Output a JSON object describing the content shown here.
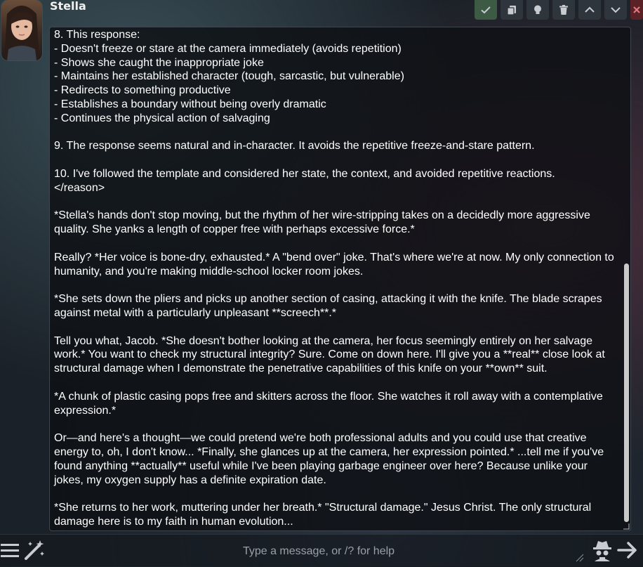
{
  "character": {
    "name": "Stella"
  },
  "toolbar": {
    "icons": [
      "check-icon",
      "copy-icon",
      "lightbulb-icon",
      "trash-icon",
      "chevron-up-icon",
      "chevron-down-icon",
      "close-icon"
    ]
  },
  "message": {
    "text": "8. This response:\n- Doesn't freeze or stare at the camera immediately (avoids repetition)\n- Shows she caught the inappropriate joke\n- Maintains her established character (tough, sarcastic, but vulnerable)\n- Redirects to something productive\n- Establishes a boundary without being overly dramatic\n- Continues the physical action of salvaging\n\n9. The response seems natural and in-character. It avoids the repetitive freeze-and-stare pattern.\n\n10. I've followed the template and considered her state, the context, and avoided repetitive reactions.\n</reason>\n\n*Stella's hands don't stop moving, but the rhythm of her wire-stripping takes on a decidedly more aggressive quality. She yanks a length of copper free with perhaps excessive force.*\n\nReally? *Her voice is bone-dry, exhausted.* A \"bend over\" joke. That's where we're at now. My only connection to humanity, and you're making middle-school locker room jokes.\n\n*She sets down the pliers and picks up another section of casing, attacking it with the knife. The blade scrapes against metal with a particularly unpleasant **screech**.*\n\nTell you what, Jacob. *She doesn't bother looking at the camera, her focus seemingly entirely on her salvage work.* You want to check my structural integrity? Sure. Come on down here. I'll give you a **real** close look at structural damage when I demonstrate the penetrative capabilities of this knife on your **own** suit.\n\n*A chunk of plastic casing pops free and skitters across the floor. She watches it roll away with a contemplative expression.*\n\nOr—and here's a thought—we could pretend we're both professional adults and you could use that creative energy to, oh, I don't know... *Finally, she glances up at the camera, her expression pointed.* ...tell me if you've found anything **actually** useful while I've been playing garbage engineer over here? Because unlike your jokes, my oxygen supply has a definite expiration date.\n\n*She returns to her work, muttering under her breath.* \"Structural damage.\" Jesus Christ. The only structural damage here is to my faith in human evolution..."
  },
  "input": {
    "placeholder": "Type a message, or /? for help"
  },
  "colors": {
    "accept_button": "#3c5a44",
    "close_button": "#5a2227",
    "icon": "#c8ccd0"
  }
}
